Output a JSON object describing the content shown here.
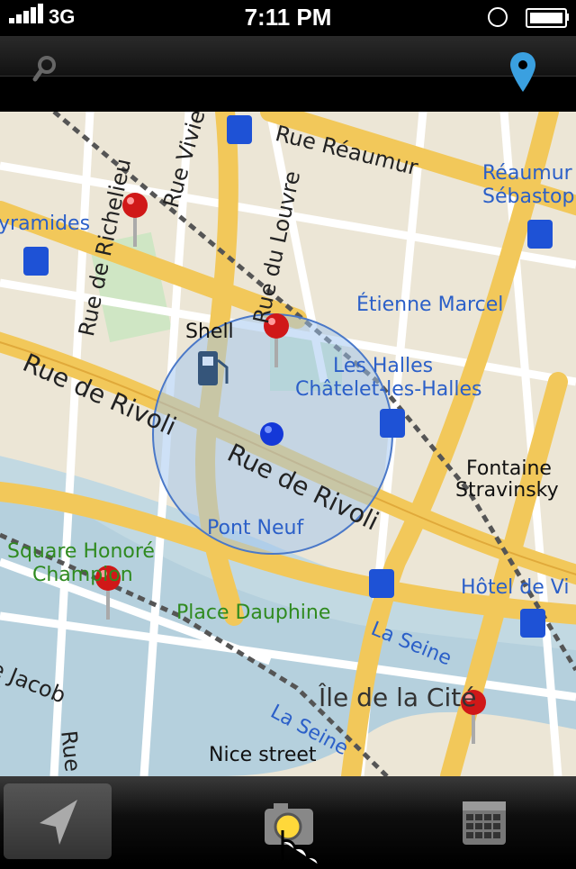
{
  "status_bar": {
    "carrier": "3G",
    "time": "7:11 PM"
  },
  "toolbar_icons": {
    "left": "search-icon",
    "right": "location-pin-icon"
  },
  "map": {
    "labels": {
      "rue_reaumur": "Rue Réaumur",
      "reaumur_sebastopol": "Réaumur -",
      "reaumur_sebastopol_2": "Sébastop",
      "pyramides": "yramides",
      "rue_de_richelieu": "Rue de Richelieu",
      "rue_vivienne": "Rue Vivie",
      "rue_du_louvre": "Rue du Louvre",
      "etienne_marcel": "Étienne Marcel",
      "shell": "Shell",
      "les_halles": "Les Halles",
      "chatelet": "Châtelet-les-Halles",
      "rue_de_rivoli_1": "Rue de Rivoli",
      "rue_de_rivoli_2": "Rue de Rivoli",
      "fontaine_stravinsky_1": "Fontaine",
      "fontaine_stravinsky_2": "Stravinsky",
      "pont_neuf": "Pont Neuf",
      "square_honore_1": "Square Honoré",
      "square_honore_2": "Champion",
      "hotel_de_ville": "Hôtel de Vi",
      "place_dauphine": "Place Dauphine",
      "la_seine_1": "La Seine",
      "la_seine_2": "La Seine",
      "rue_de_seine": "Rue de Seine",
      "rue_jacob": "e Jacob",
      "ile_de_la_cite": "Île de la Cité",
      "nice_street": "Nice street"
    },
    "pin_count": 5,
    "accent_color": "#3aa0e0"
  },
  "tab_icons": [
    "navigation-arrow-icon",
    "camera-icon",
    "calendar-icon"
  ]
}
